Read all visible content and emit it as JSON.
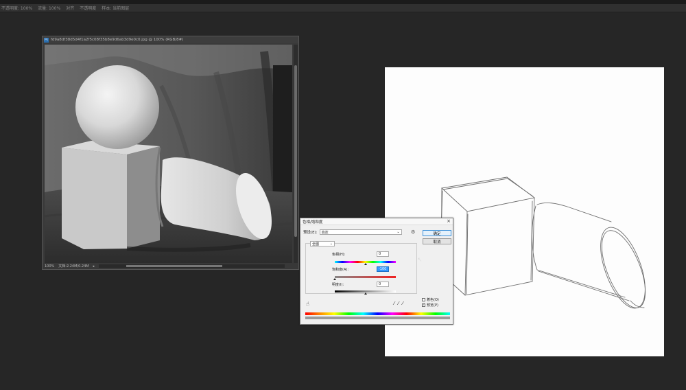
{
  "options_bar": {
    "items": [
      "不透明度: 100%",
      "流量: 100%",
      "对齐",
      "不透明度",
      "样本: 当前图层"
    ]
  },
  "photo_window": {
    "title": "fd9a8df38d5d4f1a2f5c08f35b8e9d6ab3d9e0c0.jpg @ 100% (RGB/8#)",
    "ps_icon": "Ps",
    "zoom": "100%",
    "doc_info": "文档:2.24M/0.24M"
  },
  "dialog": {
    "title": "色相/饱和度",
    "preset_label": "预设(E):",
    "preset_value": "自定",
    "ok_label": "确定",
    "cancel_label": "取消",
    "channel_value": "全图",
    "hue_label": "色相(H):",
    "hue_value": "0",
    "saturation_label": "饱和度(A):",
    "saturation_value": "-100",
    "lightness_label": "明度(I):",
    "lightness_value": "0",
    "colorize_label": "着色(O)",
    "preview_label": "预览(P)",
    "colorize_checked": false,
    "preview_checked": true,
    "hue_level": 0,
    "saturation_level": -100,
    "lightness_level": 0
  }
}
